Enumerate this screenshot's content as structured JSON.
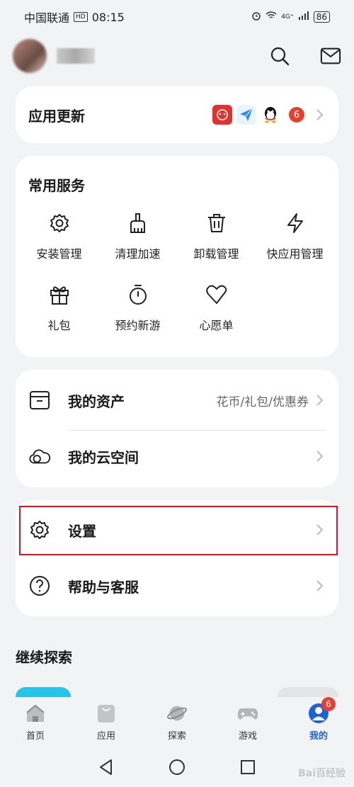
{
  "status_bar": {
    "carrier": "中国联通",
    "hd": "HD",
    "time": "08:15",
    "signal_indicator": "4G⁺",
    "battery": "86"
  },
  "profile": {
    "avatar": "avatar-blurred",
    "username": ""
  },
  "app_updates": {
    "label": "应用更新",
    "badge_count": "6"
  },
  "services": {
    "title": "常用服务",
    "items": [
      {
        "label": "安装管理",
        "icon": "gear-icon"
      },
      {
        "label": "清理加速",
        "icon": "broom-icon"
      },
      {
        "label": "卸载管理",
        "icon": "trash-icon"
      },
      {
        "label": "快应用管理",
        "icon": "bolt-icon"
      },
      {
        "label": "礼包",
        "icon": "gift-icon"
      },
      {
        "label": "预约新游",
        "icon": "stopwatch-icon"
      },
      {
        "label": "心愿单",
        "icon": "heart-icon"
      }
    ]
  },
  "assets": {
    "label": "我的资产",
    "sub": "花币/礼包/优惠券"
  },
  "cloud": {
    "label": "我的云空间"
  },
  "settings": {
    "label": "设置"
  },
  "help": {
    "label": "帮助与客服"
  },
  "explore": {
    "title": "继续探索"
  },
  "tabbar": {
    "items": [
      {
        "label": "首页",
        "icon": "home-icon"
      },
      {
        "label": "应用",
        "icon": "bag-icon"
      },
      {
        "label": "探索",
        "icon": "planet-icon"
      },
      {
        "label": "游戏",
        "icon": "gamepad-icon"
      },
      {
        "label": "我的",
        "icon": "person-icon",
        "badge": "6"
      }
    ]
  },
  "watermark": "Bai百经验",
  "colors": {
    "accent": "#1d62d8",
    "badge": "#e2412f",
    "highlight": "#d3162a",
    "background": "#f1f3f5"
  }
}
